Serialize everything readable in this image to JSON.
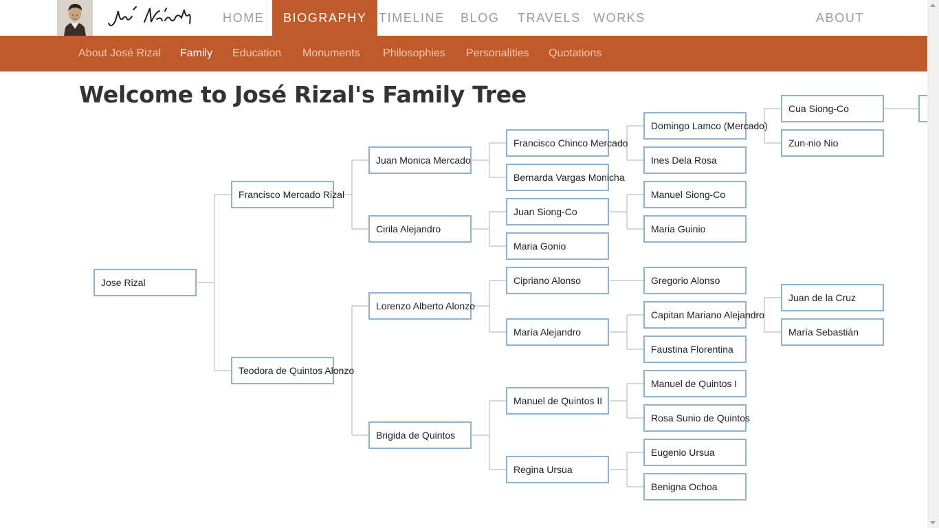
{
  "nav": {
    "home": "HOME",
    "biography": "BIOGRAPHY",
    "timeline": "TIMELINE",
    "blog": "BLOG",
    "travels": "TRAVELS",
    "works": "WORKS",
    "about": "ABOUT",
    "active": "biography"
  },
  "subnav": {
    "about": "About José Rizal",
    "family": "Family",
    "education": "Education",
    "monuments": "Monuments",
    "philosophies": "Philosophies",
    "personalities": "Personalities",
    "quotations": "Quotations",
    "active": "family"
  },
  "colors": {
    "accent": "#bf5a2b",
    "node_border": "#8fb2cf",
    "connector": "#c8c8c8"
  },
  "page_title": "Welcome to José Rizal's Family Tree",
  "tree": {
    "root": "Jose Rizal",
    "gen1": [
      "Francisco Mercado Rizal",
      "Teodora de Quintos Alonzo"
    ],
    "gen2": [
      "Juan Monica Mercado",
      "Cirila Alejandro",
      "Lorenzo Alberto Alonzo",
      "Brigida de Quintos"
    ],
    "gen3": [
      "Francisco Chinco Mercado",
      "Bernarda Vargas Monicha",
      "Juan Siong-Co",
      "Maria Gonio",
      "Cipriano Alonso",
      "María Alejandro",
      "Manuel de Quintos II",
      "Regina Ursua"
    ],
    "gen4": [
      "Domingo Lamco (Mercado)",
      "Ines Dela Rosa",
      "Manuel Siong-Co",
      "Maria Guinio",
      "Gregorio Alonso",
      "Capitan Mariano Alejandro",
      "Faustina Florentina",
      "Manuel de Quintos I",
      "Rosa Sunio de Quintos",
      "Eugenio Ursua",
      "Benigna Ochoa"
    ],
    "gen5": [
      "Cua Siong-Co",
      "Zun-nio Nio",
      "Juan de la Cruz",
      "María Sebastián"
    ]
  }
}
